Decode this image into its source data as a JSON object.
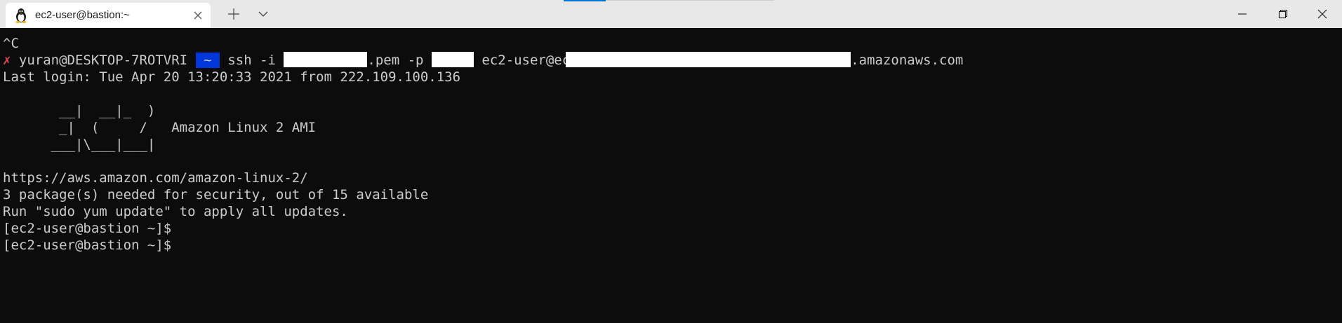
{
  "tab": {
    "title": "ec2-user@bastion:~",
    "icon": "linux-penguin-icon"
  },
  "window": {
    "new_tab_icon": "plus-icon",
    "dropdown_icon": "chevron-down-icon",
    "controls": [
      "minimize-icon",
      "maximize-icon",
      "close-icon"
    ]
  },
  "colors": {
    "terminal_bg": "#0c0c0c",
    "terminal_fg": "#cccccc",
    "prompt_highlight": "#0037da",
    "error_mark": "#e74856",
    "titlebar_bg": "#e8e8e8"
  },
  "terminal": {
    "line1": "^C",
    "cmd": {
      "mark": "✗",
      "user_host": " yuran@DESKTOP-7ROTVRI ",
      "prompt_left": "",
      "prompt_dir": " ~ ",
      "prompt_right": "",
      "ssh": " ssh -i ",
      "pem": ".pem -p ",
      "user_prefix": " ec2-user@ec",
      "host_suffix": ".amazonaws.com"
    },
    "last_login": "Last login: Tue Apr 20 13:20:33 2021 from 222.109.100.136",
    "ascii_art": [
      "       __|  __|_  )",
      "       _|  (     /   Amazon Linux 2 AMI",
      "      ___|\\___|___|"
    ],
    "url": "https://aws.amazon.com/amazon-linux-2/",
    "security_notice": "3 package(s) needed for security, out of 15 available",
    "update_hint": "Run \"sudo yum update\" to apply all updates.",
    "prompt_lines": [
      "[ec2-user@bastion ~]$",
      "[ec2-user@bastion ~]$"
    ]
  }
}
